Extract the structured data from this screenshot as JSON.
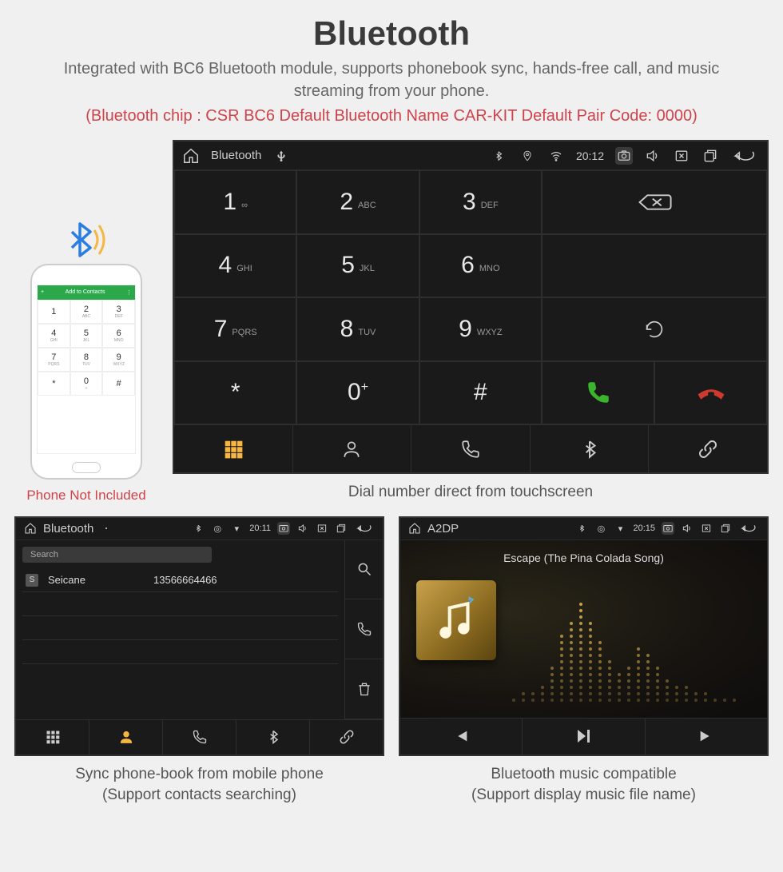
{
  "page": {
    "title": "Bluetooth",
    "subtitle": "Integrated with BC6 Bluetooth module, supports phonebook sync, hands-free call, and music streaming from your phone.",
    "specs": "(Bluetooth chip : CSR BC6    Default Bluetooth Name CAR-KIT    Default Pair Code: 0000)"
  },
  "phone": {
    "top": "Add to Contacts",
    "caption": "Phone Not Included",
    "keys": [
      {
        "n": "1",
        "l": ""
      },
      {
        "n": "2",
        "l": "ABC"
      },
      {
        "n": "3",
        "l": "DEF"
      },
      {
        "n": "4",
        "l": "GHI"
      },
      {
        "n": "5",
        "l": "JKL"
      },
      {
        "n": "6",
        "l": "MNO"
      },
      {
        "n": "7",
        "l": "PQRS"
      },
      {
        "n": "8",
        "l": "TUV"
      },
      {
        "n": "9",
        "l": "WXYZ"
      },
      {
        "n": "*",
        "l": ""
      },
      {
        "n": "0",
        "l": "+"
      },
      {
        "n": "#",
        "l": ""
      }
    ]
  },
  "dialer": {
    "statusbar": {
      "title": "Bluetooth",
      "time": "20:12"
    },
    "keys": [
      {
        "n": "1",
        "l": "∞"
      },
      {
        "n": "2",
        "l": "ABC"
      },
      {
        "n": "3",
        "l": "DEF"
      },
      {
        "n": "4",
        "l": "GHI"
      },
      {
        "n": "5",
        "l": "JKL"
      },
      {
        "n": "6",
        "l": "MNO"
      },
      {
        "n": "7",
        "l": "PQRS"
      },
      {
        "n": "8",
        "l": "TUV"
      },
      {
        "n": "9",
        "l": "WXYZ"
      },
      {
        "n": "*",
        "l": ""
      },
      {
        "n": "0",
        "l": "+"
      },
      {
        "n": "#",
        "l": ""
      }
    ],
    "caption": "Dial number direct from touchscreen"
  },
  "contacts": {
    "statusbar": {
      "title": "Bluetooth",
      "time": "20:11"
    },
    "search_placeholder": "Search",
    "list": [
      {
        "badge": "S",
        "name": "Seicane",
        "number": "13566664466"
      }
    ],
    "caption_line1": "Sync phone-book from mobile phone",
    "caption_line2": "(Support contacts searching)"
  },
  "music": {
    "statusbar": {
      "title": "A2DP",
      "time": "20:15"
    },
    "track": "Escape (The Pina Colada Song)",
    "caption_line1": "Bluetooth music compatible",
    "caption_line2": "(Support display music file name)"
  }
}
